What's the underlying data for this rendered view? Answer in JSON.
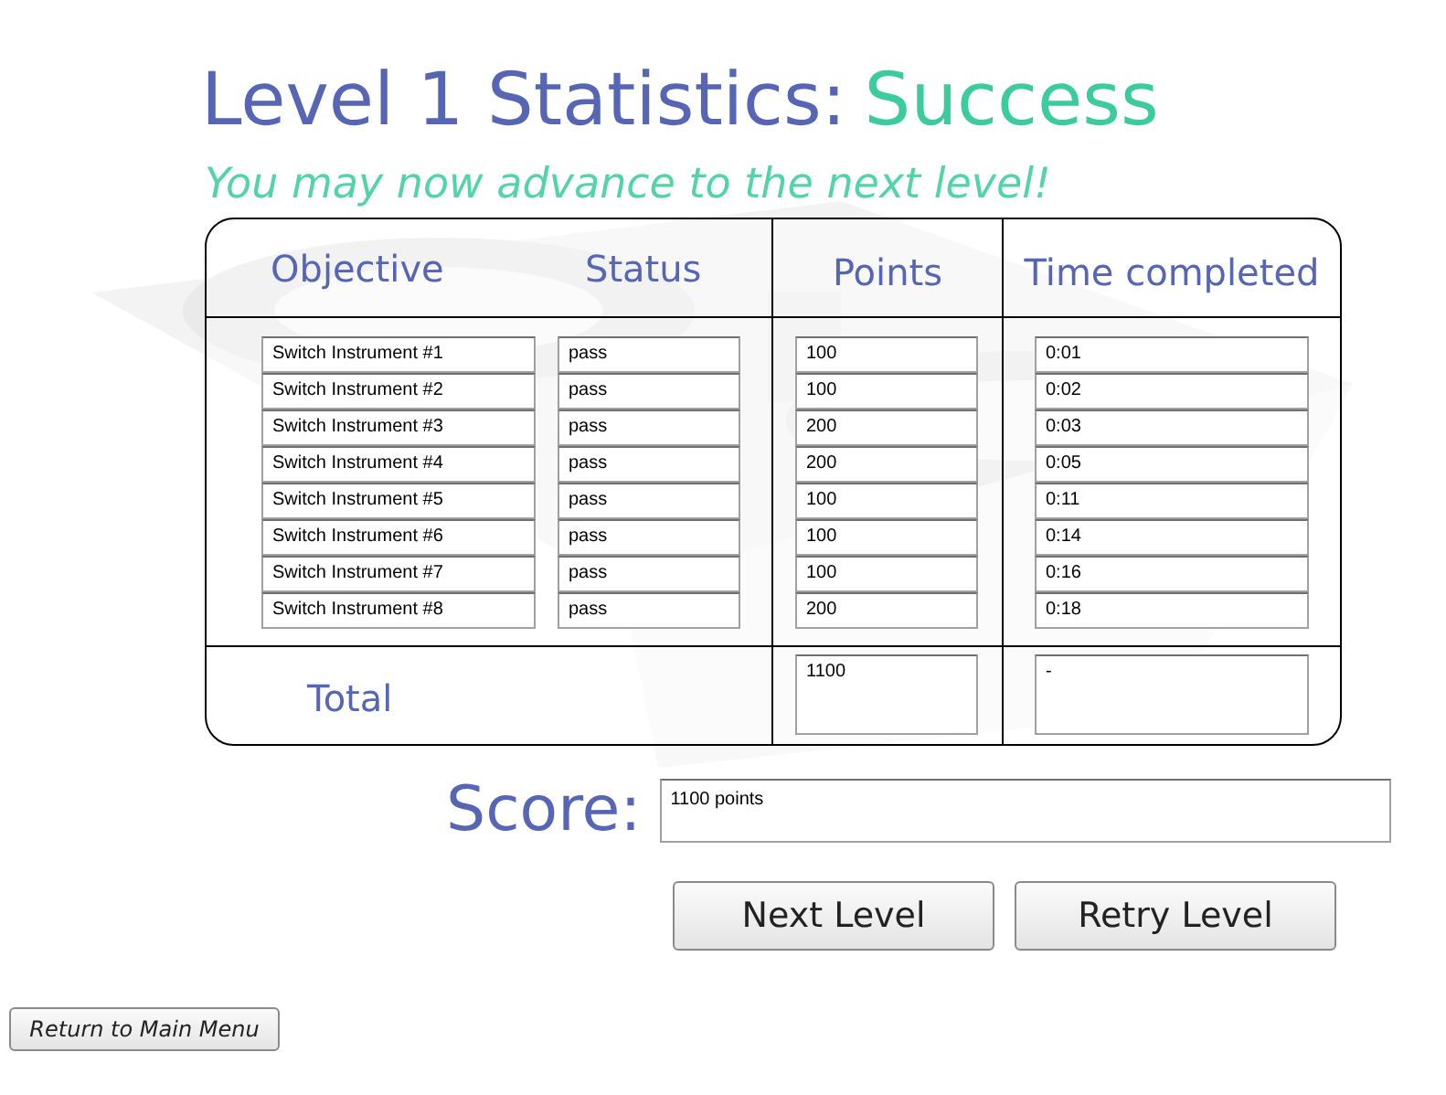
{
  "title": {
    "prefix": "Level 1 Statistics:",
    "result": "Success"
  },
  "subtitle": "You may now advance to the next level!",
  "table": {
    "columns": [
      "Objective",
      "Status",
      "Points",
      "Time completed"
    ],
    "rows": [
      {
        "objective": "Switch Instrument #1",
        "status": "pass",
        "points": "100",
        "time": "0:01"
      },
      {
        "objective": "Switch Instrument #2",
        "status": "pass",
        "points": "100",
        "time": "0:02"
      },
      {
        "objective": "Switch Instrument #3",
        "status": "pass",
        "points": "200",
        "time": "0:03"
      },
      {
        "objective": "Switch Instrument #4",
        "status": "pass",
        "points": "200",
        "time": "0:05"
      },
      {
        "objective": "Switch Instrument #5",
        "status": "pass",
        "points": "100",
        "time": "0:11"
      },
      {
        "objective": "Switch Instrument #6",
        "status": "pass",
        "points": "100",
        "time": "0:14"
      },
      {
        "objective": "Switch Instrument #7",
        "status": "pass",
        "points": "100",
        "time": "0:16"
      },
      {
        "objective": "Switch Instrument #8",
        "status": "pass",
        "points": "200",
        "time": "0:18"
      }
    ],
    "total": {
      "label": "Total",
      "points": "1100",
      "time": "-"
    }
  },
  "score": {
    "label": "Score:",
    "value": "1100 points"
  },
  "buttons": [
    "Next Level",
    "Retry Level"
  ],
  "menu_button": "Return to Main Menu"
}
